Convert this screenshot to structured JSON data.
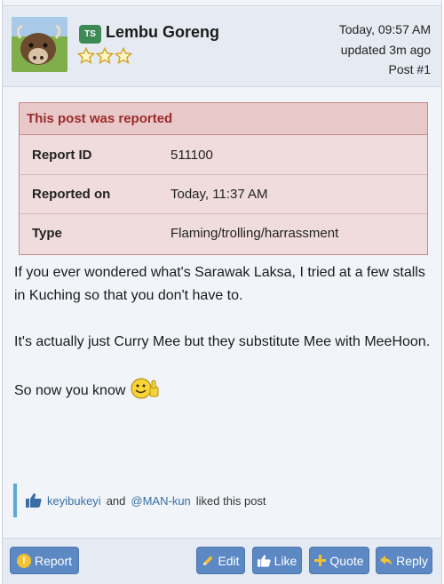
{
  "post": {
    "author": {
      "badge": "TS",
      "name": "Lembu Goreng",
      "rating_stars": 3
    },
    "meta": {
      "posted": "Today, 09:57 AM",
      "updated": "updated 3m ago",
      "post_number": "Post #1"
    }
  },
  "report": {
    "title": "This post was reported",
    "rows": [
      {
        "key": "Report ID",
        "value": "511100"
      },
      {
        "key": "Reported on",
        "value": "Today, 11:37 AM"
      },
      {
        "key": "Type",
        "value": "Flaming/trolling/harrassment"
      }
    ]
  },
  "content": {
    "para1": "If you ever wondered what's Sarawak Laksa, I tried at a few stalls in Kuching so that you don't have to.",
    "para2": "It's actually just Curry Mee but they substitute Mee with MeeHoon.",
    "para3": "So now you know"
  },
  "likes": {
    "user1": "keyibukeyi",
    "joiner": "and",
    "user2": "@MAN-kun",
    "suffix": "liked this post"
  },
  "actions": {
    "report": "Report",
    "edit": "Edit",
    "like": "Like",
    "quote": "Quote",
    "reply": "Reply"
  },
  "colors": {
    "button": "#5c88c4",
    "badge": "#3d8a55",
    "report_title": "#9c2b2b",
    "report_bg": "#f0dcdc",
    "like_rule": "#5aa9dd"
  }
}
